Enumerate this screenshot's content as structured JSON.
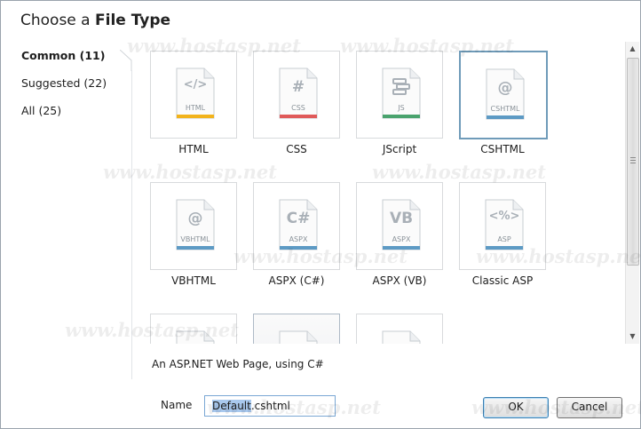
{
  "dialog": {
    "title_prefix": "Choose a",
    "title_strong": "File Type"
  },
  "categories": [
    {
      "label": "Common (11)",
      "active": true
    },
    {
      "label": "Suggested (22)",
      "active": false
    },
    {
      "label": "All (25)",
      "active": false
    }
  ],
  "tiles": [
    {
      "label": "HTML",
      "glyph": "</>",
      "badge": "HTML",
      "accent": "#f2b31c",
      "icon": "html-file-icon"
    },
    {
      "label": "CSS",
      "glyph": "#",
      "badge": "CSS",
      "accent": "#e05a5a",
      "icon": "css-file-icon"
    },
    {
      "label": "JScript",
      "glyph": "",
      "badge": "JS",
      "accent": "#4aa36e",
      "icon": "js-file-icon"
    },
    {
      "label": "CSHTML",
      "glyph": "@",
      "badge": "CSHTML",
      "accent": "#5d9ac4",
      "icon": "cshtml-file-icon",
      "selected": true
    },
    {
      "label": "VBHTML",
      "glyph": "@",
      "badge": "VBHTML",
      "accent": "#5d9ac4",
      "icon": "vbhtml-file-icon"
    },
    {
      "label": "ASPX (C#)",
      "glyph": "C#",
      "badge": "ASPX",
      "accent": "#5d9ac4",
      "icon": "aspx-cs-file-icon"
    },
    {
      "label": "ASPX (VB)",
      "glyph": "VB",
      "badge": "ASPX",
      "accent": "#5d9ac4",
      "icon": "aspx-vb-file-icon"
    },
    {
      "label": "Classic ASP",
      "glyph": "<%>",
      "badge": "ASP",
      "accent": "#5d9ac4",
      "icon": "asp-file-icon"
    },
    {
      "label": "",
      "glyph": "",
      "badge": "",
      "accent": "#5d9ac4",
      "icon": "file-icon"
    },
    {
      "label": "",
      "glyph": "",
      "badge": "",
      "accent": "#5d9ac4",
      "icon": "file-icon",
      "gray": true
    },
    {
      "label": "",
      "glyph": "",
      "badge": "",
      "accent": "#5d9ac4",
      "icon": "file-icon"
    }
  ],
  "description": "An ASP.NET Web Page, using C#",
  "name_field": {
    "label": "Name",
    "selected_part": "Default",
    "rest": ".cshtml"
  },
  "buttons": {
    "ok": "OK",
    "cancel": "Cancel"
  },
  "watermark": "www.hostasp.net",
  "colors": {
    "selection_border": "#6f9bb9",
    "ok_border": "#3c7fb1"
  }
}
